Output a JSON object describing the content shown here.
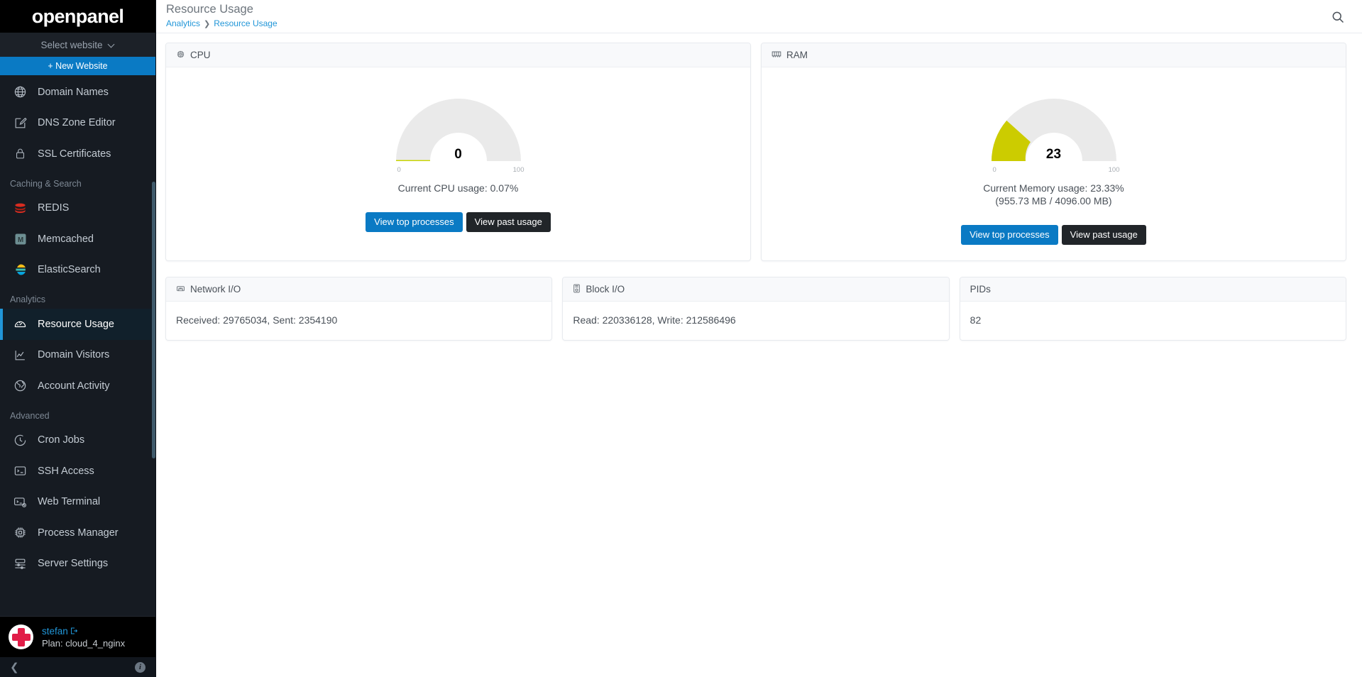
{
  "brand": {
    "name": "openpanel"
  },
  "sidebar": {
    "site_selector": {
      "label": "Select website",
      "icon": "chevron-down-icon"
    },
    "new_website": {
      "label": "+ New Website"
    },
    "items": [
      {
        "label": "Domain Names",
        "icon": "globe-icon",
        "type": "link",
        "active": false
      },
      {
        "label": "DNS Zone Editor",
        "icon": "edit-square-icon",
        "type": "link",
        "active": false
      },
      {
        "label": "SSL Certificates",
        "icon": "lock-icon",
        "type": "link",
        "active": false
      },
      {
        "label": "Caching & Search",
        "type": "section"
      },
      {
        "label": "REDIS",
        "icon": "redis-icon",
        "type": "link",
        "active": false
      },
      {
        "label": "Memcached",
        "icon": "memcached-icon",
        "type": "link",
        "active": false
      },
      {
        "label": "ElasticSearch",
        "icon": "elasticsearch-icon",
        "type": "link",
        "active": false
      },
      {
        "label": "Analytics",
        "type": "section"
      },
      {
        "label": "Resource Usage",
        "icon": "gauge-icon",
        "type": "link",
        "active": true
      },
      {
        "label": "Domain Visitors",
        "icon": "line-chart-icon",
        "type": "link",
        "active": false
      },
      {
        "label": "Account Activity",
        "icon": "globe-activity-icon",
        "type": "link",
        "active": false
      },
      {
        "label": "Advanced",
        "type": "section"
      },
      {
        "label": "Cron Jobs",
        "icon": "clock-icon",
        "type": "link",
        "active": false
      },
      {
        "label": "SSH Access",
        "icon": "terminal-icon",
        "type": "link",
        "active": false
      },
      {
        "label": "Web Terminal",
        "icon": "web-terminal-icon",
        "type": "link",
        "active": false
      },
      {
        "label": "Process Manager",
        "icon": "cpu-chip-icon",
        "type": "link",
        "active": false
      },
      {
        "label": "Server Settings",
        "icon": "sliders-icon",
        "type": "link",
        "active": false
      }
    ],
    "user": {
      "name": "stefan",
      "logout_icon": "logout-icon",
      "plan": "Plan: cloud_4_nginx",
      "avatar_icon": "openpanel-cross-avatar"
    },
    "footer": {
      "collapse_icon": "chevron-left-icon",
      "info_icon": "info-icon"
    }
  },
  "header": {
    "title": "Resource Usage",
    "breadcrumb": [
      "Analytics",
      "Resource Usage"
    ],
    "breadcrumb_separator": "❯",
    "search_icon": "search-icon"
  },
  "colors": {
    "accent_blue": "#0a7ac4",
    "link_blue": "#2196d8",
    "dark_button": "#212529",
    "gauge_track": "#eaeaea",
    "gauge_fill_ram": "#cccc00",
    "gauge_fill_cpu": "#c8d400",
    "sidebar_bg": "#161b22",
    "brand_bg": "#000000"
  },
  "chart_data": [
    {
      "type": "gauge",
      "title": "CPU",
      "value": 0,
      "display_value": "0",
      "min": 0,
      "max": 100,
      "tick_labels": [
        "0",
        "100"
      ],
      "actual_percent": 0.07,
      "caption": "Current CPU usage: 0.07%",
      "fill_color": "#c8d400",
      "track_color": "#eaeaea"
    },
    {
      "type": "gauge",
      "title": "RAM",
      "value": 23,
      "display_value": "23",
      "min": 0,
      "max": 100,
      "tick_labels": [
        "0",
        "100"
      ],
      "actual_percent": 23.33,
      "caption": "Current Memory usage: 23.33%",
      "caption_secondary": "(955.73 MB / 4096.00 MB)",
      "fill_color": "#cccc00",
      "track_color": "#eaeaea"
    }
  ],
  "cards": {
    "cpu": {
      "title": "CPU",
      "icon": "cpu-chip-icon",
      "gauge_value": "0",
      "tick_min": "0",
      "tick_max": "100",
      "caption": "Current CPU usage: 0.07%",
      "btn_processes": "View top processes",
      "btn_past": "View past usage"
    },
    "ram": {
      "title": "RAM",
      "icon": "memory-stick-icon",
      "gauge_value": "23",
      "tick_min": "0",
      "tick_max": "100",
      "caption": "Current Memory usage: 23.33%",
      "caption2": "(955.73 MB / 4096.00 MB)",
      "btn_processes": "View top processes",
      "btn_past": "View past usage"
    },
    "network": {
      "title": "Network I/O",
      "icon": "network-icon",
      "value": "Received: 29765034, Sent: 2354190"
    },
    "block": {
      "title": "Block I/O",
      "icon": "disk-icon",
      "value": "Read: 220336128, Write: 212586496"
    },
    "pids": {
      "title": "PIDs",
      "value": "82"
    }
  }
}
